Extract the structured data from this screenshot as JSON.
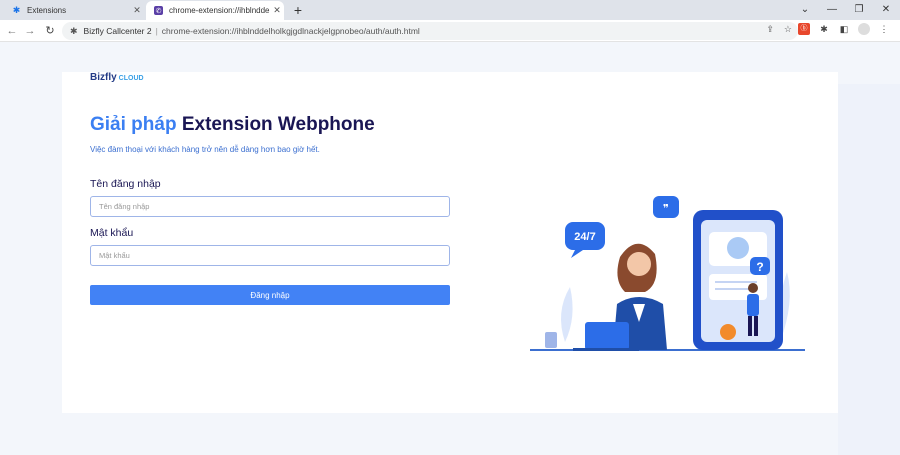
{
  "browser": {
    "tabs": [
      {
        "label": "Extensions",
        "icon": "puzzle-icon"
      },
      {
        "label": "chrome-extension://ihblnddelhc",
        "icon": "phone-icon"
      }
    ],
    "new_tab": "+",
    "window_controls": {
      "dropdown": "⌄",
      "minimize": "—",
      "maximize": "❐",
      "close": "✕"
    },
    "nav": {
      "back": "←",
      "forward": "→",
      "reload": "↻"
    },
    "omnibox": {
      "site_name": "Bizfly Callcenter 2",
      "separator": "|",
      "url": "chrome-extension://ihblnddelholkgjgdlnackjelgpnobeo/auth/auth.html"
    }
  },
  "page": {
    "logo": {
      "text": "Bizfly",
      "sub": "CLOUD"
    },
    "title_part1": "Giải pháp",
    "title_part2": "Extension Webphone",
    "subtitle": "Việc đàm thoại với khách hàng trở nên dễ dàng hơn bao giờ hết.",
    "username": {
      "label": "Tên đăng nhập",
      "placeholder": "Tên đăng nhập"
    },
    "password": {
      "label": "Mật khẩu",
      "placeholder": "Mật khẩu"
    },
    "login_button": "Đăng nhập",
    "illustration": {
      "badge_text": "24/7",
      "quote_mark": "❞",
      "question_mark": "?"
    }
  },
  "colors": {
    "accent": "#4282f5",
    "title_dark": "#1a1654",
    "title_blue": "#3b7ff2"
  }
}
